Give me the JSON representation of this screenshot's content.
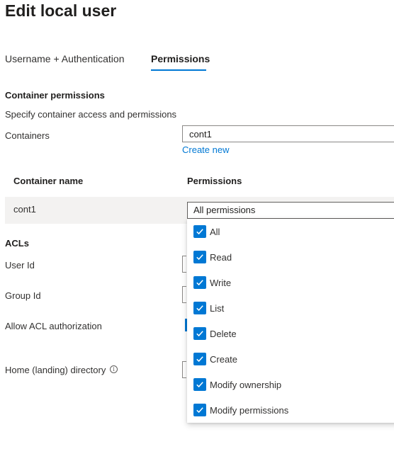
{
  "page": {
    "title": "Edit local user"
  },
  "tabs": [
    {
      "label": "Username + Authentication",
      "active": false
    },
    {
      "label": "Permissions",
      "active": true
    }
  ],
  "container_permissions": {
    "heading": "Container permissions",
    "description": "Specify container access and permissions",
    "containers_label": "Containers",
    "containers_value": "cont1",
    "create_new_link": "Create new"
  },
  "table": {
    "headers": [
      "Container name",
      "Permissions"
    ],
    "rows": [
      {
        "container": "cont1",
        "permissions": "All permissions"
      }
    ]
  },
  "permissions_dropdown": {
    "options": [
      {
        "label": "All",
        "checked": true,
        "icon": "checkmark-icon"
      },
      {
        "label": "Read",
        "checked": true,
        "icon": "checkmark-icon"
      },
      {
        "label": "Write",
        "checked": true,
        "icon": "checkmark-icon"
      },
      {
        "label": "List",
        "checked": true,
        "icon": "checkmark-icon"
      },
      {
        "label": "Delete",
        "checked": true,
        "icon": "checkmark-icon"
      },
      {
        "label": "Create",
        "checked": true,
        "icon": "checkmark-icon"
      },
      {
        "label": "Modify ownership",
        "checked": true,
        "icon": "checkmark-icon"
      },
      {
        "label": "Modify permissions",
        "checked": true,
        "icon": "checkmark-icon"
      }
    ]
  },
  "acls": {
    "heading": "ACLs",
    "user_id_label": "User Id",
    "group_id_label": "Group Id",
    "allow_acl_label": "Allow ACL authorization",
    "home_directory_label": "Home (landing) directory",
    "info_icon": "info-icon"
  },
  "colors": {
    "accent": "#0078d4",
    "text": "#323130",
    "row_background": "#f3f2f1",
    "border": "#8a8886"
  }
}
